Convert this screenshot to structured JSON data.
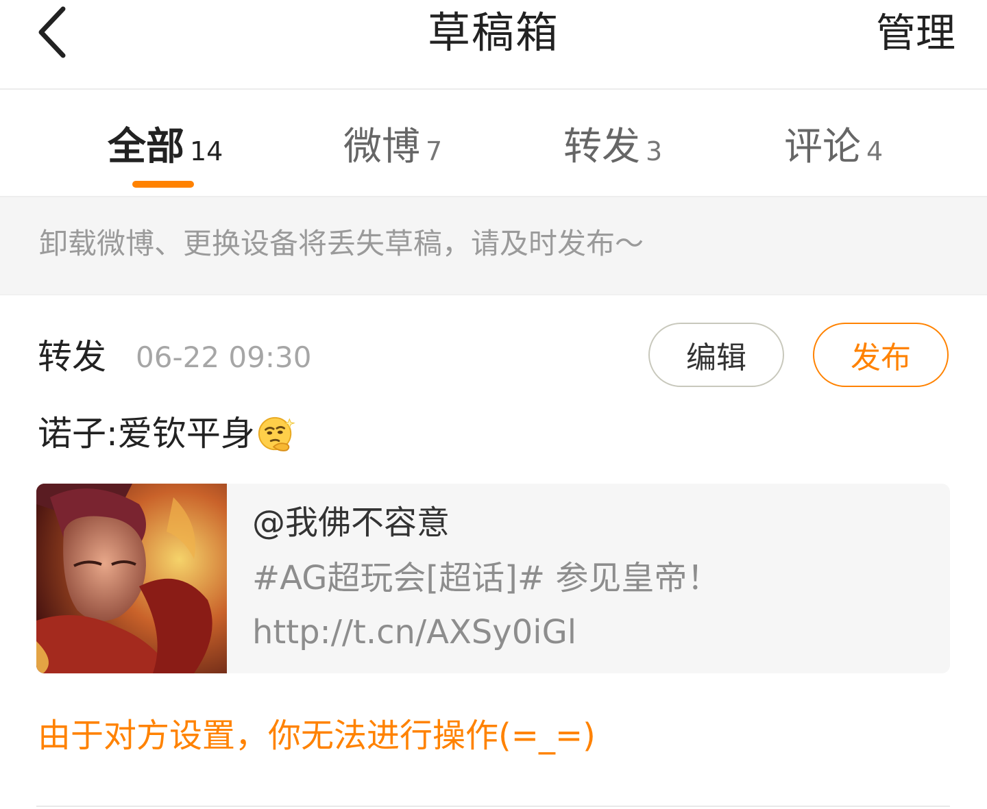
{
  "header": {
    "back_icon": "chevron-left-icon",
    "title": "草稿箱",
    "manage_label": "管理"
  },
  "tabs": [
    {
      "label": "全部",
      "count": "14",
      "active": true
    },
    {
      "label": "微博",
      "count": "7",
      "active": false
    },
    {
      "label": "转发",
      "count": "3",
      "active": false
    },
    {
      "label": "评论",
      "count": "4",
      "active": false
    }
  ],
  "notice": {
    "text": "卸载微博、更换设备将丢失草稿，请及时发布～"
  },
  "draft": {
    "type": "转发",
    "time": "06-22 09:30",
    "edit_label": "编辑",
    "publish_label": "发布",
    "text": "诺子:爱钦平身",
    "emoji_icon": "thinking-emoji-icon",
    "quote": {
      "author": "@我佛不容意",
      "line1": "#AG超玩会[超话]#  参见皇帝！",
      "line2": "http://t.cn/AXSy0iGl"
    },
    "warning": "由于对方设置，你无法进行操作(=_=)"
  },
  "colors": {
    "accent": "#ff8200",
    "text_primary": "#222222",
    "text_muted": "#9a9a9a",
    "notice_bg": "#f5f5f5",
    "card_bg": "#f6f6f6"
  }
}
